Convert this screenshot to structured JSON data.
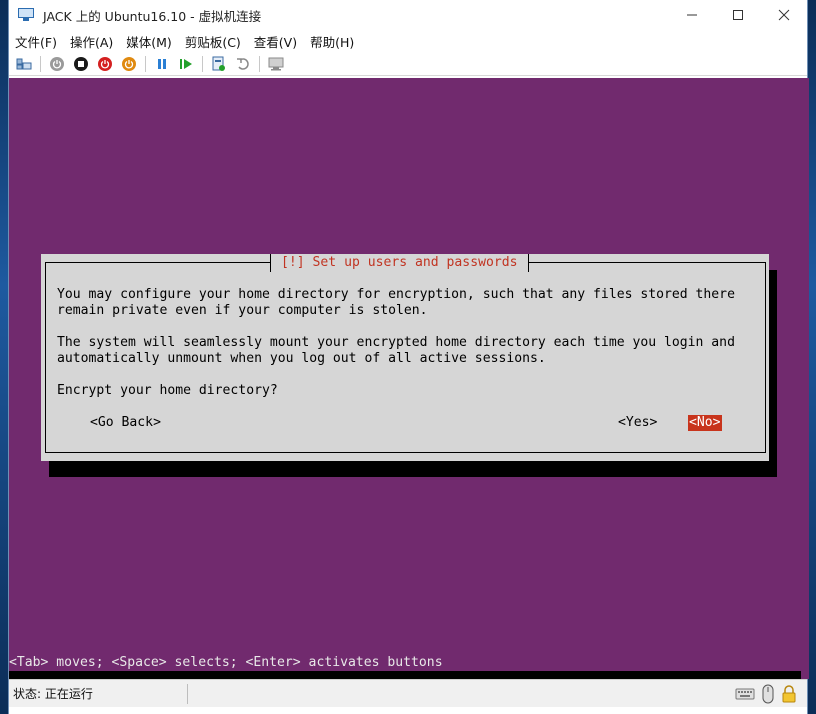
{
  "window": {
    "title": "JACK 上的 Ubuntu16.10 - 虚拟机连接",
    "controls": {
      "minimize_icon": "minimize-icon",
      "maximize_icon": "maximize-icon",
      "close_icon": "close-icon"
    }
  },
  "menu": {
    "items": [
      {
        "label": "文件(F)"
      },
      {
        "label": "操作(A)"
      },
      {
        "label": "媒体(M)"
      },
      {
        "label": "剪贴板(C)"
      },
      {
        "label": "查看(V)"
      },
      {
        "label": "帮助(H)"
      }
    ]
  },
  "toolbar": {
    "buttons": [
      {
        "icon": "ctrl-alt-del-icon"
      },
      {
        "icon": "start-icon"
      },
      {
        "icon": "turn-off-icon"
      },
      {
        "icon": "shutdown-icon"
      },
      {
        "icon": "save-icon"
      },
      {
        "icon": "pause-icon"
      },
      {
        "icon": "resume-icon"
      },
      {
        "icon": "checkpoint-icon"
      },
      {
        "icon": "revert-icon"
      },
      {
        "icon": "enhanced-session-icon"
      }
    ]
  },
  "installer": {
    "dialog_title": "[!] Set up users and passwords",
    "lines": [
      "You may configure your home directory for encryption, such that any files stored there",
      "remain private even if your computer is stolen.",
      "The system will seamlessly mount your encrypted home directory each time you login and",
      "automatically unmount when you log out of all active sessions.",
      "Encrypt your home directory?"
    ],
    "buttons": {
      "go_back": "<Go Back>",
      "yes": "<Yes>",
      "no": "<No>"
    },
    "help_line": "<Tab> moves; <Space> selects; <Enter> activates buttons",
    "colors": {
      "background": "#712a6e",
      "dialog": "#d6d6d6",
      "title": "#c13422",
      "selected_button": "#c8341c"
    }
  },
  "statusbar": {
    "status": "状态: 正在运行",
    "icons": [
      "keyboard-icon",
      "mouse-icon",
      "lock-icon"
    ]
  }
}
